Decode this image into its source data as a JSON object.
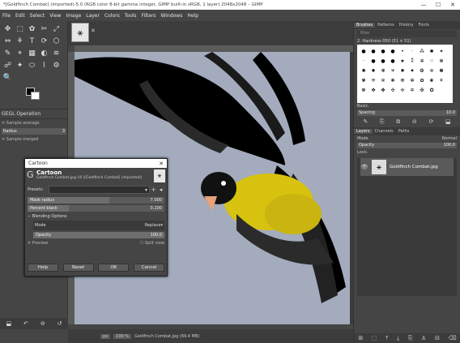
{
  "window": {
    "title": "*[Goldfinch Combat] (imported)-5.0 (RGB color 8-bit gamma integer, GIMP built-in sRGB, 1 layer) 2048x2048 – GIMP",
    "min": "—",
    "max": "☐",
    "close": "✕"
  },
  "menu": [
    "File",
    "Edit",
    "Select",
    "View",
    "Image",
    "Layer",
    "Colors",
    "Tools",
    "Filters",
    "Windows",
    "Help"
  ],
  "toolbox": {
    "tools": [
      "✥",
      "⬚",
      "✿",
      "✂",
      "⤢",
      "⇔",
      "⚘",
      "T",
      "⟳",
      "⬡",
      "✎",
      "⌖",
      "▦",
      "◐",
      "≋",
      "☍",
      "✦",
      "⬭",
      "⌇",
      "⚙",
      "🔍"
    ],
    "gegl_header": "GEGL Operation",
    "sample_average": "Sample average",
    "radius_label": "Radius",
    "radius_value": "3",
    "sample_merged": "Sample merged",
    "bottom_icons": [
      "⬓",
      "↶",
      "⊖",
      "↺"
    ]
  },
  "image_tab": {
    "thumb": "⚹",
    "close": "✕"
  },
  "status": {
    "unit": "px",
    "zoom": "100 %",
    "text": "Goldfinch Combat.jpg (69.4 MB)"
  },
  "dock": {
    "top_tabs": [
      "Brushes",
      "Patterns",
      "History",
      "Fonts"
    ],
    "filter_placeholder": "filter",
    "brush_name": "2. Hardness 050 (51 × 51)",
    "brush_glyphs": [
      "●",
      "●",
      "●",
      "●",
      "•",
      "·",
      "⁂",
      "✱",
      "✶",
      "·",
      "●",
      "●",
      "●",
      "★",
      "⁑",
      "✲",
      "⁙",
      "✻",
      "✺",
      "✹",
      "❋",
      "✳",
      "✸",
      "✷",
      "❂",
      "❈",
      "✽",
      "✾",
      "⁜",
      "※",
      "❃",
      "❉",
      "✼",
      "✿",
      "❀",
      "⚘",
      "☸",
      "✥",
      "✤",
      "✣",
      "✢",
      "✡",
      "✠",
      "✪"
    ],
    "tag_label": "Basic,",
    "spacing_label": "Spacing",
    "spacing_value": "10.0",
    "brush_icons": [
      "✎",
      "⎘",
      "⧉",
      "⊖",
      "⟳",
      "⬓"
    ],
    "layer_tabs": [
      "Layers",
      "Channels",
      "Paths"
    ],
    "mode_label": "Mode",
    "mode_value": "Normal",
    "opacity_label": "Opacity",
    "opacity_value": "100.0",
    "lock_label": "Lock:",
    "layer_name": "Goldfinch Combat.jpg",
    "layer_thumb": "⚹",
    "layer_icons": [
      "⊞",
      "⬚",
      "⤒",
      "⤓",
      "⎘",
      "⚓",
      "⊟",
      "⌫"
    ]
  },
  "dialog": {
    "title": "Cartoon",
    "name": "Cartoon",
    "subtitle": "Goldfinch Combat.jpg-16 ([Goldfinch Combat] (imported))",
    "presets_label": "Presets:",
    "mask_radius_label": "Mask radius",
    "mask_radius_value": "7.000",
    "mask_radius_fraction": 0.6,
    "percent_black_label": "Percent black",
    "percent_black_value": "0.200",
    "percent_black_fraction": 0.3,
    "blending_label": "Blending Options",
    "mode_label": "Mode",
    "mode_value": "Replace",
    "opacity_label": "Opacity",
    "opacity_value": "100.0",
    "opacity_fraction": 1.0,
    "preview_label": "Preview",
    "split_view_label": "Split view",
    "buttons": {
      "help": "Help",
      "reset": "Reset",
      "ok": "OK",
      "cancel": "Cancel"
    }
  }
}
